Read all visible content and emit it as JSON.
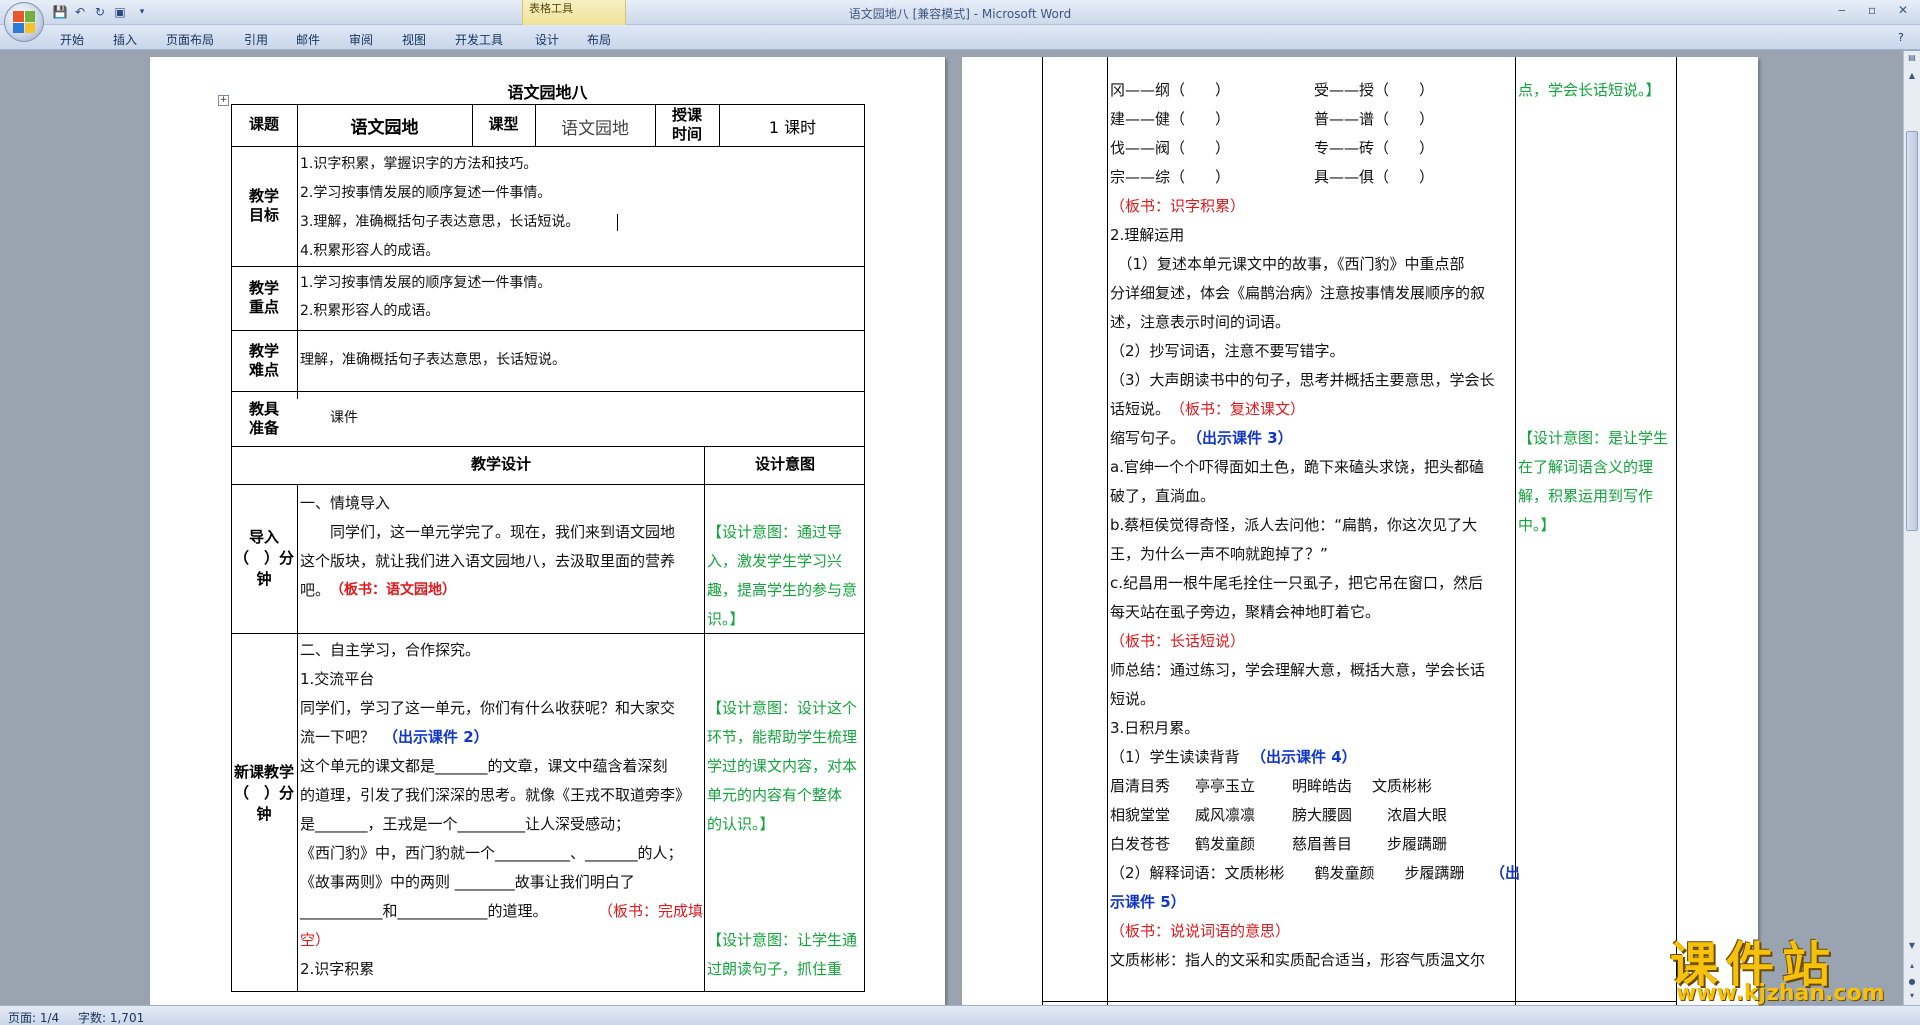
{
  "window": {
    "title": "语文园地八 [兼容模式] - Microsoft Word",
    "context_group": "表格工具",
    "minimize": "‒",
    "restore": "▫",
    "close": "✕"
  },
  "ribbon": {
    "tabs": [
      "开始",
      "插入",
      "页面布局",
      "引用",
      "邮件",
      "审阅",
      "视图",
      "开发工具",
      "设计",
      "布局"
    ]
  },
  "page1": {
    "title": "语文园地八",
    "header": {
      "c1": "课题",
      "c2": "语文园地",
      "c3": "课型",
      "c4": "语文园地",
      "c5": "授课时间",
      "c6": "1 课时"
    },
    "goals": {
      "label": "教学目标",
      "lines": [
        "1.识字积累，掌握识字的方法和技巧。",
        "2.学习按事情发展的顺序复述一件事情。",
        "3.理解，准确概括句子表达意思，长话短说。",
        "4.积累形容人的成语。"
      ]
    },
    "focus": {
      "label": "教学重点",
      "lines": [
        "1.学习按事情发展的顺序复述一件事情。",
        "2.积累形容人的成语。"
      ]
    },
    "difficulty": {
      "label": "教学难点",
      "line": "理解，准确概括句子表达意思，长话短说。"
    },
    "tools": {
      "label": "教具准备",
      "line": "课件"
    },
    "design_header": {
      "left": "教学设计",
      "right": "设计意图"
    },
    "intro": {
      "label": "导入（　）分钟",
      "lines": [
        "一、情境导入",
        "　　同学们，这一单元学完了。现在，我们来到语文园地",
        "这个版块，就让我们进入语文园地八，去汲取里面的营养",
        "吧。"
      ],
      "board": "（板书：语文园地）",
      "intent_lines": [
        "【设计意图：通过导",
        "入，激发学生学习兴",
        "趣，提高学生的参与意",
        "识。】"
      ]
    },
    "new": {
      "label": "新课教学（　）分钟",
      "lines": [
        "二、自主学习，合作探究。",
        "1.交流平台",
        "同学们，学习了这一单元，你们有什么收获呢？和大家交",
        "流一下吧？",
        "这个单元的课文都是_______的文章，课文中蕴含着深刻",
        "的道理，引发了我们深深的思考。就像《王戎不取道旁李》",
        "是_______，王戎是一个_________让人深受感动；",
        "《西门豹》中，西门豹就一个__________、_______的人；",
        "《故事两则》中的两则 ________故事让我们明白了",
        "___________和____________的道理。",
        "空）",
        "2.识字积累"
      ],
      "courseware2": "（出示课件 2）",
      "board_fill": "（板书：完成填",
      "intent1_lines": [
        "【设计意图：设计这个",
        "环节，能帮助学生梳理",
        "学过的课文内容，对本",
        "单元的内容有个整体",
        "的认识。】"
      ],
      "intent2_lines": [
        "【设计意图：让学生通",
        "过朗读句子，抓住重"
      ]
    }
  },
  "page2": {
    "pairs": [
      [
        "冈——纲（　　）",
        "受——授（　　）"
      ],
      [
        "建——健（　　）",
        "普——谱（　　）"
      ],
      [
        "伐——阀（　　）",
        "专——砖（　　）"
      ],
      [
        "宗——综（　　）",
        "具——俱（　　）"
      ]
    ],
    "board1": "（板书：识字积累）",
    "s2": "2.理解运用",
    "p1_lines": [
      "　（1）复述本单元课文中的故事，《西门豹》中重点部",
      "分详细复述，体会《扁鹊治病》注意按事情发展顺序的叙",
      "述，注意表示时间的词语。"
    ],
    "p2": "（2）抄写词语，注意不要写错字。",
    "p3a": "（3）大声朗读书中的句子，思考并概括主要意思，学会长",
    "p3b": "话短说。",
    "board2": "（板书：复述课文）",
    "shorten": "缩写句子。",
    "courseware3": "（出示课件 3）",
    "ex_lines": [
      "a.官绅一个个吓得面如土色，跪下来磕头求饶，把头都磕",
      "破了，直淌血。",
      "b.蔡桓侯觉得奇怪，派人去问他：“扁鹊，你这次见了大",
      "王，为什么一声不响就跑掉了？”",
      "c.纪昌用一根牛尾毛拴住一只虱子，把它吊在窗口，然后",
      "每天站在虱子旁边，聚精会神地盯着它。"
    ],
    "board3": "（板书：长话短说）",
    "summary_lines": [
      "师总结：通过练习，学会理解大意，概括大意，学会长话",
      "短说。"
    ],
    "s3": "3.日积月累。",
    "read": "（1）学生读读背背",
    "courseware4": "（出示课件 4）",
    "idiom_rows": [
      [
        "眉清目秀",
        "亭亭玉立",
        "明眸皓齿",
        "文质彬彬"
      ],
      [
        "相貌堂堂",
        "威风凛凛",
        "膀大腰圆",
        "浓眉大眼"
      ],
      [
        "白发苍苍",
        "鹤发童颜",
        "慈眉善目",
        "步履蹒跚"
      ]
    ],
    "explain": "（2）解释词语：文质彬彬　　鹤发童颜　　步履蹒跚",
    "courseware5a": "（出",
    "courseware5b": "示课件 5）",
    "board4": "（板书：说说词语的意思）",
    "last": "文质彬彬：指人的文采和实质配合适当，形容气质温文尔",
    "intent_top": "点，学会长话短说。】",
    "intent_mid": [
      "【设计意图：是让学生",
      "在了解词语含义的理",
      "解，积累运用到写作",
      "中。】"
    ]
  },
  "status": {
    "page": "页面: 1/4",
    "words": "字数: 1,701"
  },
  "watermark": {
    "big": "课件站",
    "url": "www.kjzhan.com"
  }
}
